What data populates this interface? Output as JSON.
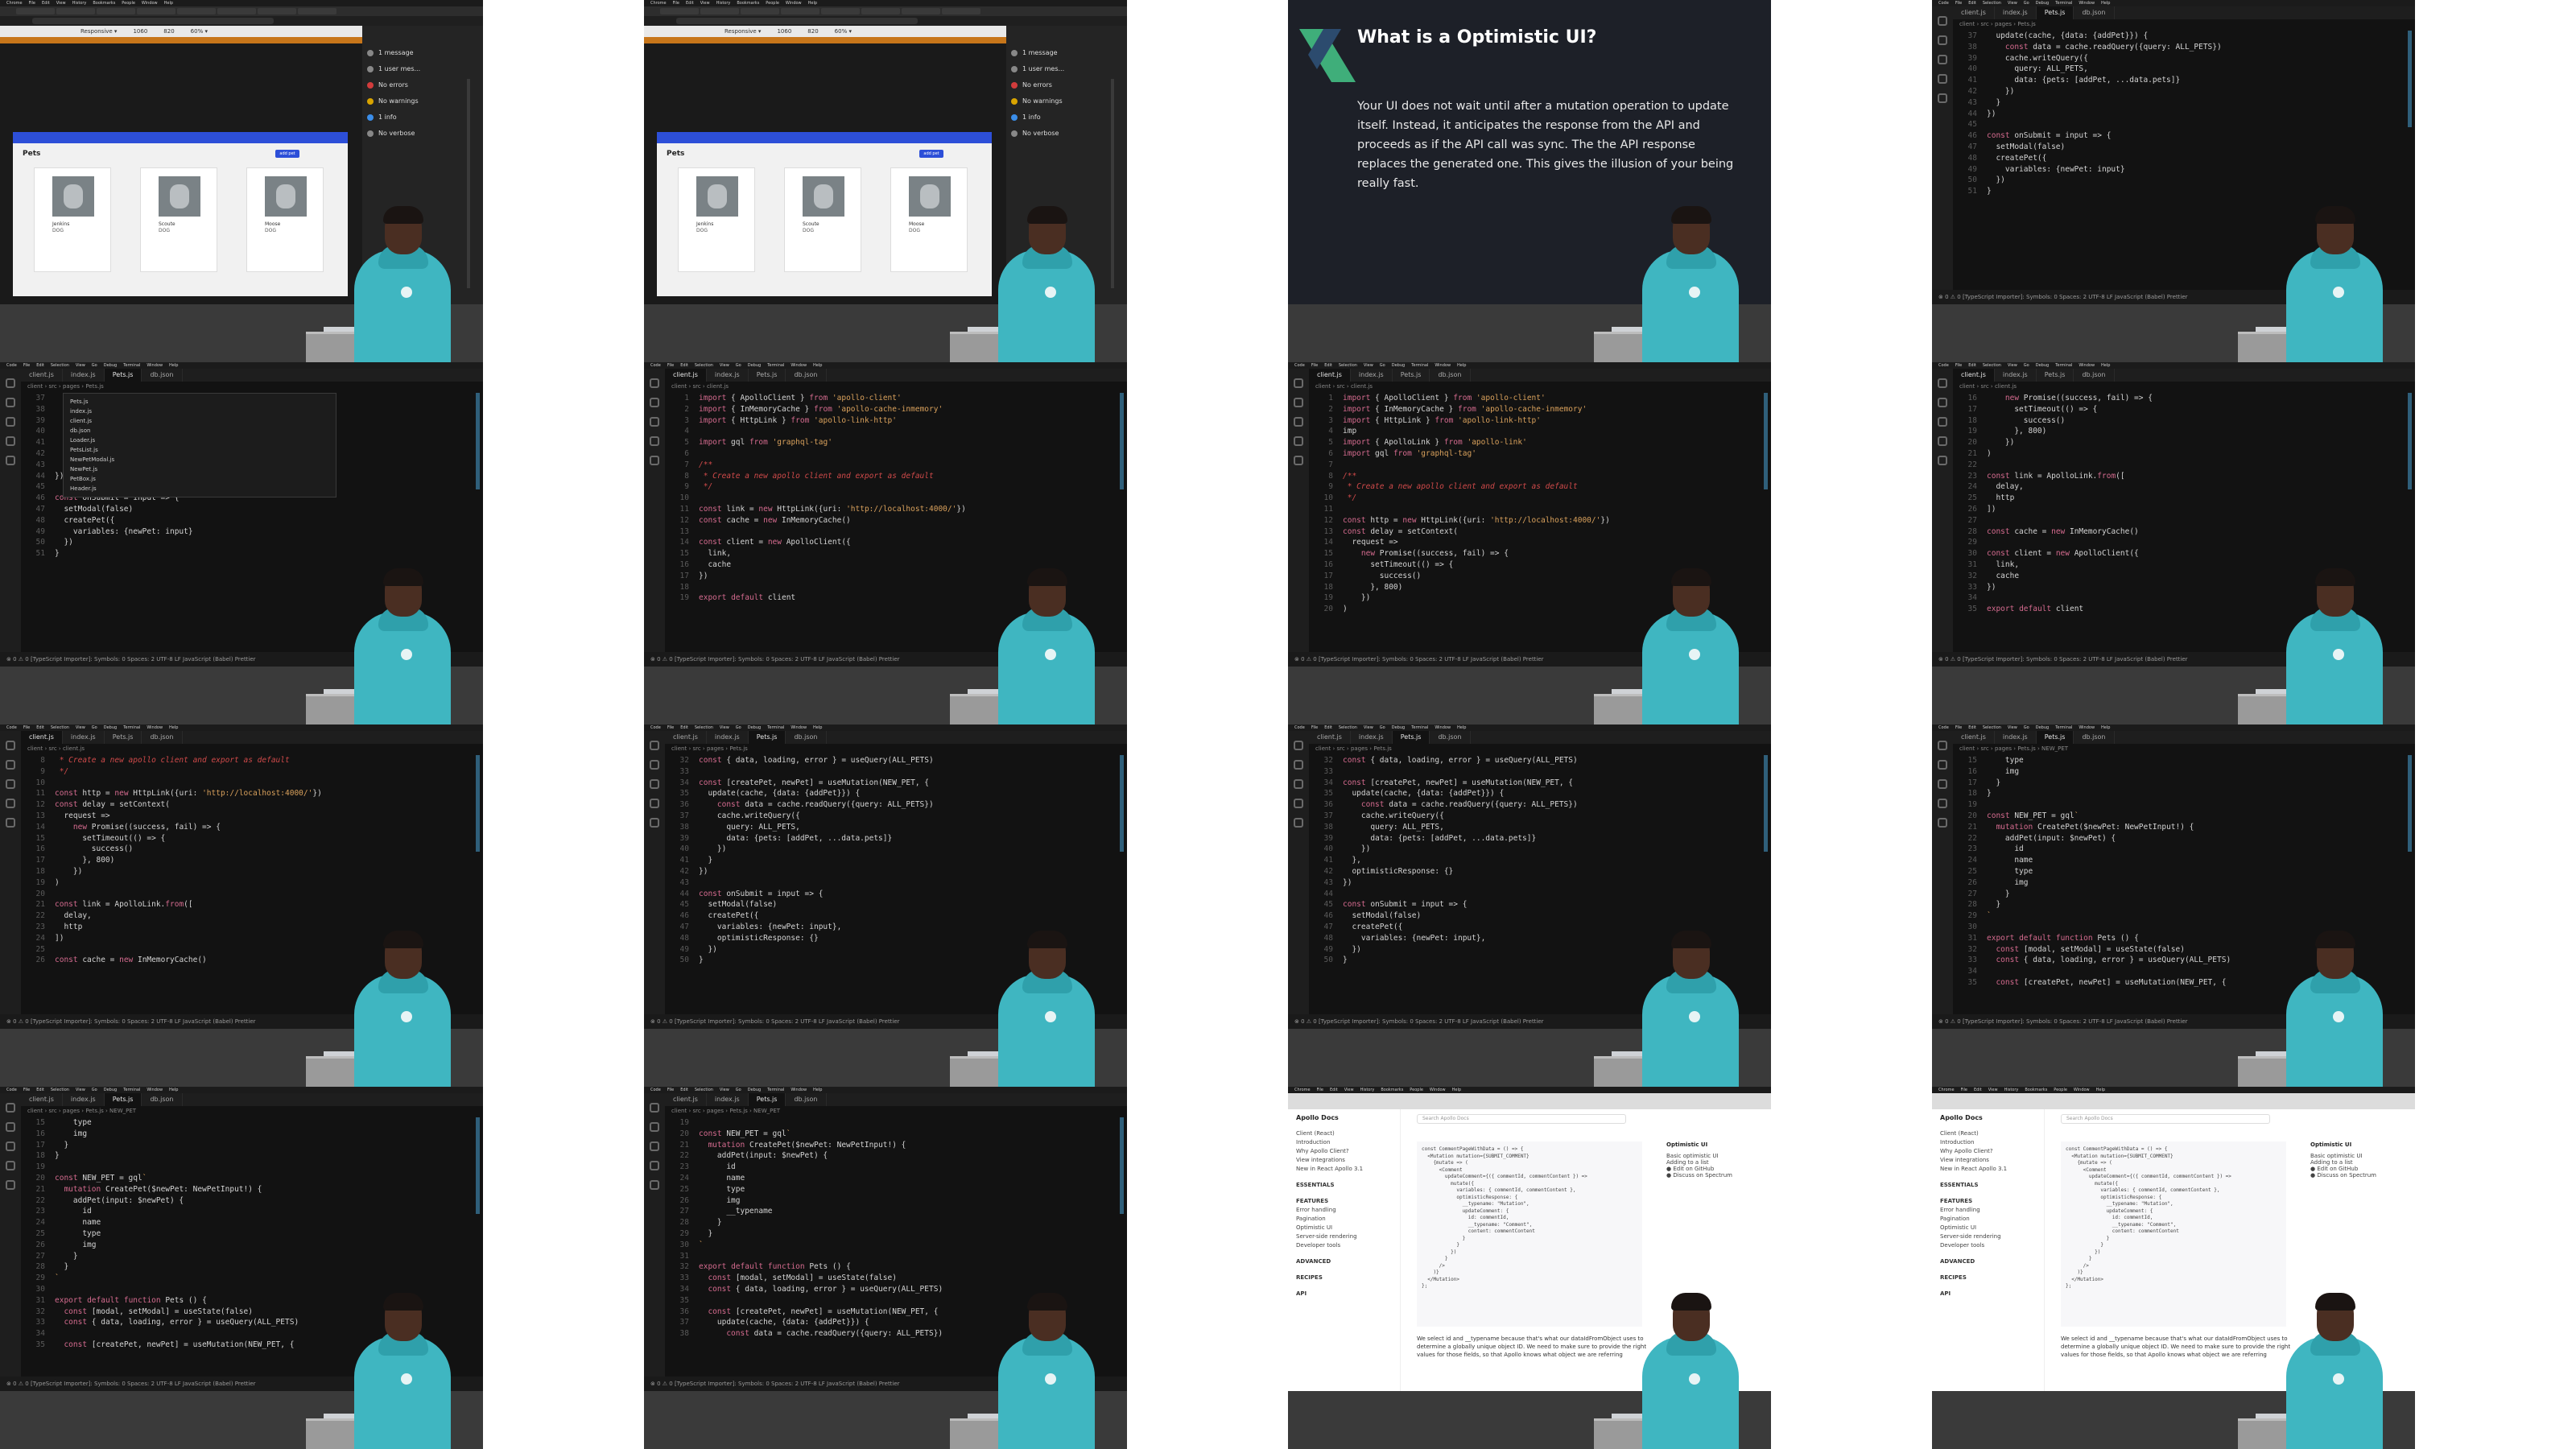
{
  "mac_menu": [
    "Chrome",
    "File",
    "Edit",
    "View",
    "History",
    "Bookmarks",
    "People",
    "Window",
    "Help"
  ],
  "code_menu": [
    "Code",
    "File",
    "Edit",
    "Selection",
    "View",
    "Go",
    "Debug",
    "Terminal",
    "Window",
    "Help"
  ],
  "browser": {
    "devtools": {
      "device": "Responsive",
      "width": "1060",
      "height": "820",
      "zoom": "60%"
    },
    "console_filters": [
      "1 message",
      "1 user mes...",
      "No errors",
      "No warnings",
      "1 info",
      "No verbose"
    ],
    "pets_page": {
      "title": "Pets",
      "add_button": "add pet",
      "cards": [
        {
          "name": "Jenkins",
          "type": "DOG"
        },
        {
          "name": "Scoute",
          "type": "DOG"
        },
        {
          "name": "Moose",
          "type": "DOG"
        }
      ]
    }
  },
  "slide": {
    "title": "What is a Optimistic UI?",
    "body": "Your UI does not wait until after a mutation operation to update itself. Instead, it anticipates the response from the API and proceeds as if the API call was sync. The the API response replaces the generated one. This gives the illusion of your being really fast."
  },
  "editor": {
    "tabs": [
      "client.js",
      "index.js",
      "Pets.js",
      "db.json"
    ],
    "status": "⊗ 0 ⚠ 0   [TypeScript Importer]: Symbols: 0        Spaces: 2   UTF-8   LF   JavaScript (Babel)   Prettier",
    "file_picker": [
      "Pets.js",
      "index.js",
      "client.js",
      "db.json",
      "Loader.js",
      "PetsList.js",
      "NewPetModal.js",
      "NewPet.js",
      "PetBox.js",
      "Header.js"
    ],
    "snippets": {
      "pets_update": [
        [
          "37",
          "  update(cache, {data: {addPet}}) {"
        ],
        [
          "38",
          "    const data = cache.readQuery({query: ALL_PETS})"
        ],
        [
          "39",
          "    cache.writeQuery({"
        ],
        [
          "40",
          "      query: ALL_PETS,"
        ],
        [
          "41",
          "      data: {pets: [addPet, ...data.pets]}"
        ],
        [
          "42",
          "    })"
        ],
        [
          "43",
          "  }"
        ],
        [
          "44",
          "})"
        ],
        [
          "45",
          ""
        ],
        [
          "46",
          "const onSubmit = input => {"
        ],
        [
          "47",
          "  setModal(false)"
        ],
        [
          "48",
          "  createPet({"
        ],
        [
          "49",
          "    variables: {newPet: input}"
        ],
        [
          "50",
          "  })"
        ],
        [
          "51",
          "}"
        ]
      ],
      "client_basic": [
        [
          "1",
          "import { ApolloClient } from 'apollo-client'"
        ],
        [
          "2",
          "import { InMemoryCache } from 'apollo-cache-inmemory'"
        ],
        [
          "3",
          "import { HttpLink } from 'apollo-link-http'"
        ],
        [
          "4",
          ""
        ],
        [
          "5",
          "import gql from 'graphql-tag'"
        ],
        [
          "6",
          ""
        ],
        [
          "7",
          "/**"
        ],
        [
          "8",
          " * Create a new apollo client and export as default"
        ],
        [
          "9",
          " */"
        ],
        [
          "10",
          ""
        ],
        [
          "11",
          "const link = new HttpLink({uri: 'http://localhost:4000/'})"
        ],
        [
          "12",
          "const cache = new InMemoryCache()"
        ],
        [
          "13",
          ""
        ],
        [
          "14",
          "const client = new ApolloClient({"
        ],
        [
          "15",
          "  link,"
        ],
        [
          "16",
          "  cache"
        ],
        [
          "17",
          "})"
        ],
        [
          "18",
          ""
        ],
        [
          "19",
          "export default client"
        ]
      ],
      "client_delay": [
        [
          "1",
          "import { ApolloClient } from 'apollo-client'"
        ],
        [
          "2",
          "import { InMemoryCache } from 'apollo-cache-inmemory'"
        ],
        [
          "3",
          "import { HttpLink } from 'apollo-link-http'"
        ],
        [
          "4",
          "imp"
        ],
        [
          "5",
          "import { ApolloLink } from 'apollo-link'"
        ],
        [
          "6",
          "import gql from 'graphql-tag'"
        ],
        [
          "7",
          ""
        ],
        [
          "8",
          "/**"
        ],
        [
          "9",
          " * Create a new apollo client and export as default"
        ],
        [
          "10",
          " */"
        ],
        [
          "11",
          ""
        ],
        [
          "12",
          "const http = new HttpLink({uri: 'http://localhost:4000/'})"
        ],
        [
          "13",
          "const delay = setContext("
        ],
        [
          "14",
          "  request =>"
        ],
        [
          "15",
          "    new Promise((success, fail) => {"
        ],
        [
          "16",
          "      setTimeout(() => {"
        ],
        [
          "17",
          "        success()"
        ],
        [
          "18",
          "      }, 800)"
        ],
        [
          "19",
          "    })"
        ],
        [
          "20",
          ")"
        ]
      ],
      "client_link": [
        [
          "16",
          "    new Promise((success, fail) => {"
        ],
        [
          "17",
          "      setTimeout(() => {"
        ],
        [
          "18",
          "        success()"
        ],
        [
          "19",
          "      }, 800)"
        ],
        [
          "20",
          "    })"
        ],
        [
          "21",
          ")"
        ],
        [
          "22",
          ""
        ],
        [
          "23",
          "const link = ApolloLink.from(["
        ],
        [
          "24",
          "  delay,"
        ],
        [
          "25",
          "  http"
        ],
        [
          "26",
          "])"
        ],
        [
          "27",
          ""
        ],
        [
          "28",
          "const cache = new InMemoryCache()"
        ],
        [
          "29",
          ""
        ],
        [
          "30",
          "const client = new ApolloClient({"
        ],
        [
          "31",
          "  link,"
        ],
        [
          "32",
          "  cache"
        ],
        [
          "33",
          "})"
        ],
        [
          "34",
          ""
        ],
        [
          "35",
          "export default client"
        ]
      ],
      "client_link_full": [
        [
          "8",
          " * Create a new apollo client and export as default"
        ],
        [
          "9",
          " */"
        ],
        [
          "10",
          ""
        ],
        [
          "11",
          "const http = new HttpLink({uri: 'http://localhost:4000/'})"
        ],
        [
          "12",
          "const delay = setContext("
        ],
        [
          "13",
          "  request =>"
        ],
        [
          "14",
          "    new Promise((success, fail) => {"
        ],
        [
          "15",
          "      setTimeout(() => {"
        ],
        [
          "16",
          "        success()"
        ],
        [
          "17",
          "      }, 800)"
        ],
        [
          "18",
          "    })"
        ],
        [
          "19",
          ")"
        ],
        [
          "20",
          ""
        ],
        [
          "21",
          "const link = ApolloLink.from(["
        ],
        [
          "22",
          "  delay,"
        ],
        [
          "23",
          "  http"
        ],
        [
          "24",
          "])"
        ],
        [
          "25",
          ""
        ],
        [
          "26",
          "const cache = new InMemoryCache()"
        ]
      ],
      "pets_optimistic": [
        [
          "32",
          "const { data, loading, error } = useQuery(ALL_PETS)"
        ],
        [
          "33",
          ""
        ],
        [
          "34",
          "const [createPet, newPet] = useMutation(NEW_PET, {"
        ],
        [
          "35",
          "  update(cache, {data: {addPet}}) {"
        ],
        [
          "36",
          "    const data = cache.readQuery({query: ALL_PETS})"
        ],
        [
          "37",
          "    cache.writeQuery({"
        ],
        [
          "38",
          "      query: ALL_PETS,"
        ],
        [
          "39",
          "      data: {pets: [addPet, ...data.pets]}"
        ],
        [
          "40",
          "    })"
        ],
        [
          "41",
          "  }"
        ],
        [
          "42",
          "})"
        ],
        [
          "43",
          ""
        ],
        [
          "44",
          "const onSubmit = input => {"
        ],
        [
          "45",
          "  setModal(false)"
        ],
        [
          "46",
          "  createPet({"
        ],
        [
          "47",
          "    variables: {newPet: input},"
        ],
        [
          "48",
          "    optimisticResponse: {}"
        ],
        [
          "49",
          "  })"
        ],
        [
          "50",
          "}"
        ]
      ],
      "pets_optimistic2": [
        [
          "32",
          "const { data, loading, error } = useQuery(ALL_PETS)"
        ],
        [
          "33",
          ""
        ],
        [
          "34",
          "const [createPet, newPet] = useMutation(NEW_PET, {"
        ],
        [
          "35",
          "  update(cache, {data: {addPet}}) {"
        ],
        [
          "36",
          "    const data = cache.readQuery({query: ALL_PETS})"
        ],
        [
          "37",
          "    cache.writeQuery({"
        ],
        [
          "38",
          "      query: ALL_PETS,"
        ],
        [
          "39",
          "      data: {pets: [addPet, ...data.pets]}"
        ],
        [
          "40",
          "    })"
        ],
        [
          "41",
          "  },"
        ],
        [
          "42",
          "  optimisticResponse: {}"
        ],
        [
          "43",
          "})"
        ],
        [
          "44",
          ""
        ],
        [
          "45",
          "const onSubmit = input => {"
        ],
        [
          "46",
          "  setModal(false)"
        ],
        [
          "47",
          "  createPet({"
        ],
        [
          "48",
          "    variables: {newPet: input},"
        ],
        [
          "49",
          "  })"
        ],
        [
          "50",
          "}"
        ]
      ],
      "new_pet_gql": [
        [
          "15",
          "    type"
        ],
        [
          "16",
          "    img"
        ],
        [
          "17",
          "  }"
        ],
        [
          "18",
          "}"
        ],
        [
          "19",
          ""
        ],
        [
          "20",
          "const NEW_PET = gql`"
        ],
        [
          "21",
          "  mutation CreatePet($newPet: NewPetInput!) {"
        ],
        [
          "22",
          "    addPet(input: $newPet) {"
        ],
        [
          "23",
          "      id"
        ],
        [
          "24",
          "      name"
        ],
        [
          "25",
          "      type"
        ],
        [
          "26",
          "      img"
        ],
        [
          "27",
          "    }"
        ],
        [
          "28",
          "  }"
        ],
        [
          "29",
          "`"
        ],
        [
          "30",
          ""
        ],
        [
          "31",
          "export default function Pets () {"
        ],
        [
          "32",
          "  const [modal, setModal] = useState(false)"
        ],
        [
          "33",
          "  const { data, loading, error } = useQuery(ALL_PETS)"
        ],
        [
          "34",
          ""
        ],
        [
          "35",
          "  const [createPet, newPet] = useMutation(NEW_PET, {"
        ]
      ],
      "new_pet_typename": [
        [
          "19",
          ""
        ],
        [
          "20",
          "const NEW_PET = gql`"
        ],
        [
          "21",
          "  mutation CreatePet($newPet: NewPetInput!) {"
        ],
        [
          "22",
          "    addPet(input: $newPet) {"
        ],
        [
          "23",
          "      id"
        ],
        [
          "24",
          "      name"
        ],
        [
          "25",
          "      type"
        ],
        [
          "26",
          "      img"
        ],
        [
          "27",
          "      __typename"
        ],
        [
          "28",
          "    }"
        ],
        [
          "29",
          "  }"
        ],
        [
          "30",
          "`"
        ],
        [
          "31",
          ""
        ],
        [
          "32",
          "export default function Pets () {"
        ],
        [
          "33",
          "  const [modal, setModal] = useState(false)"
        ],
        [
          "34",
          "  const { data, loading, error } = useQuery(ALL_PETS)"
        ],
        [
          "35",
          ""
        ],
        [
          "36",
          "  const [createPet, newPet] = useMutation(NEW_PET, {"
        ],
        [
          "37",
          "    update(cache, {data: {addPet}}) {"
        ],
        [
          "38",
          "      const data = cache.readQuery({query: ALL_PETS})"
        ]
      ]
    }
  },
  "docs": {
    "brand": "Apollo Docs",
    "version": "Client (React)",
    "nav": [
      "Introduction",
      "Why Apollo Client?",
      "View integrations",
      "New in React Apollo 3.1"
    ],
    "sections": [
      "ESSENTIALS",
      "FEATURES",
      "ADVANCED",
      "RECIPES",
      "API"
    ],
    "features": [
      "Error handling",
      "Pagination",
      "Optimistic UI",
      "Server-side rendering",
      "Developer tools"
    ],
    "search": "Search Apollo Docs",
    "right_title": "Optimistic UI",
    "right_links": [
      "Basic optimistic UI",
      "Adding to a list"
    ],
    "right_actions": [
      "Edit on GitHub",
      "Discuss on Spectrum"
    ],
    "code": [
      "const CommentPageWithData = () => {",
      "  <Mutation mutation={SUBMIT_COMMENT}",
      "    {mutate => (",
      "      <Comment",
      "        updateComment={({ commentId, commentContent }) =>",
      "          mutate({",
      "            variables: { commentId, commentContent },",
      "            optimisticResponse: {",
      "              __typename: \"Mutation\",",
      "              updateComment: {",
      "                id: commentId,",
      "                __typename: \"Comment\",",
      "                content: commentContent",
      "              }",
      "            }",
      "          })",
      "        }",
      "      />",
      "    )}",
      "  </Mutation>",
      "};"
    ],
    "text": "We select id and __typename because that's what our dataIdFromObject uses to determine a globally unique object ID. We need to make sure to provide the right values for those fields, so that Apollo knows what object we are referring"
  }
}
